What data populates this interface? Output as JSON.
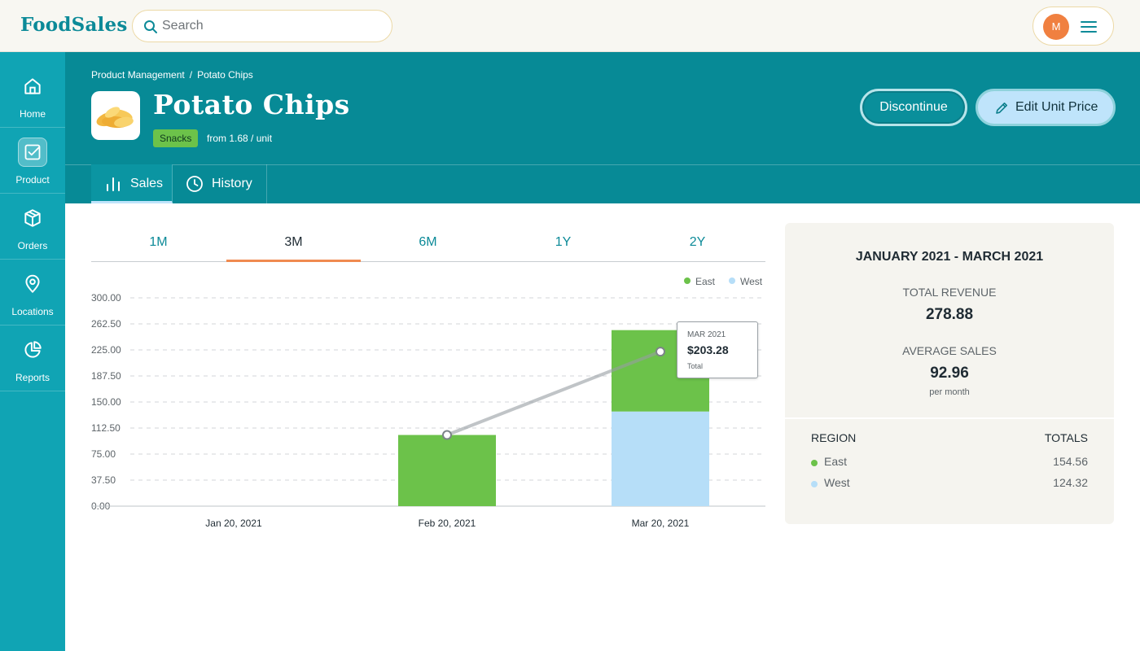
{
  "app": {
    "logo": "FoodSales"
  },
  "search": {
    "placeholder": "Search"
  },
  "user": {
    "avatar_initial": "M"
  },
  "sidebar": {
    "items": [
      {
        "label": "Home",
        "icon": "home-icon",
        "active": false
      },
      {
        "label": "Product",
        "icon": "checkbox-icon",
        "active": true
      },
      {
        "label": "Orders",
        "icon": "box-icon",
        "active": false
      },
      {
        "label": "Locations",
        "icon": "map-pin-icon",
        "active": false
      },
      {
        "label": "Reports",
        "icon": "pie-chart-icon",
        "active": false
      }
    ]
  },
  "header": {
    "breadcrumb": [
      "Product Management",
      "Potato Chips"
    ],
    "breadcrumb_separator": "/",
    "title": "Potato Chips",
    "category": "Snacks",
    "price_note": "from 1.68 / unit",
    "discontinue_label": "Discontinue",
    "edit_price_label": "Edit Unit Price",
    "tabs": [
      {
        "label": "Sales",
        "icon": "bar-chart-icon",
        "active": true
      },
      {
        "label": "History",
        "icon": "clock-icon",
        "active": false
      }
    ]
  },
  "colors": {
    "east": "#6cc24a",
    "west": "#b6def8",
    "accent": "#0c8a98",
    "header": "#078a96",
    "sidebar": "#10a4b4",
    "active_range": "#f08a50"
  },
  "range_tabs": {
    "items": [
      "1M",
      "3M",
      "6M",
      "1Y",
      "2Y"
    ],
    "active": "3M"
  },
  "chart_data": {
    "type": "bar",
    "stacked": true,
    "categories": [
      "Jan 20, 2021",
      "Feb 20, 2021",
      "Mar 20, 2021"
    ],
    "series": [
      {
        "name": "East",
        "values": [
          0,
          102.5,
          117.2
        ]
      },
      {
        "name": "West",
        "values": [
          0,
          0,
          136.3
        ]
      }
    ],
    "total_line": [
      null,
      102.5,
      222.5
    ],
    "yticks": [
      "0.00",
      "37.50",
      "75.00",
      "112.50",
      "150.00",
      "187.50",
      "225.00",
      "262.50",
      "300.00"
    ],
    "ylim": [
      0,
      300
    ],
    "grid": true,
    "legend": "top-right",
    "tooltip": {
      "period": "MAR 2021",
      "value": "$203.28",
      "label": "Total"
    }
  },
  "summary": {
    "period": "JANUARY 2021 - MARCH 2021",
    "total_revenue_label": "TOTAL REVENUE",
    "total_revenue": "278.88",
    "average_sales_label": "AVERAGE SALES",
    "average_sales": "92.96",
    "average_sales_unit": "per month",
    "region_header": "REGION",
    "totals_header": "TOTALS",
    "regions": [
      {
        "name": "East",
        "total": "154.56"
      },
      {
        "name": "West",
        "total": "124.32"
      }
    ]
  }
}
